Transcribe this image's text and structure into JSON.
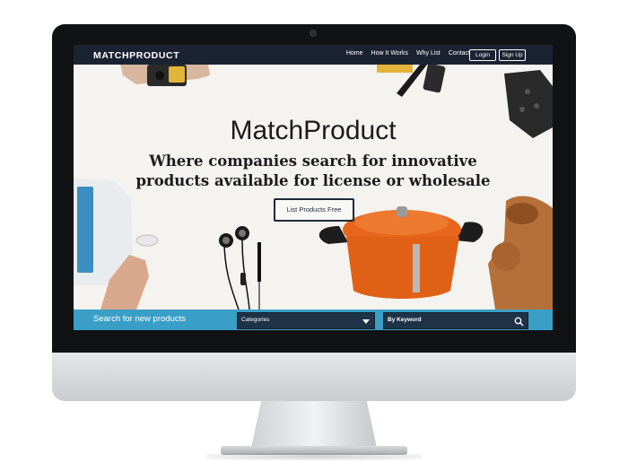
{
  "nav": {
    "logo": "MATCHPRODUCT",
    "links": [
      "Home",
      "How It Works",
      "Why List",
      "Contact"
    ],
    "login_label": "Login",
    "signup_label": "Sign Up"
  },
  "hero": {
    "title": "MatchProduct",
    "subtitle_line1": "Where companies search for innovative",
    "subtitle_line2": "products available for license or wholesale",
    "cta_label": "List Products Free"
  },
  "search": {
    "label": "Search for new products",
    "category_value": "Categories",
    "keyword_placeholder": "By Keyword"
  },
  "colors": {
    "nav_bg": "#1b2333",
    "search_bar_bg": "#3a9fc6",
    "input_bg": "#1e3347",
    "hero_bg": "#f4f3ef"
  }
}
